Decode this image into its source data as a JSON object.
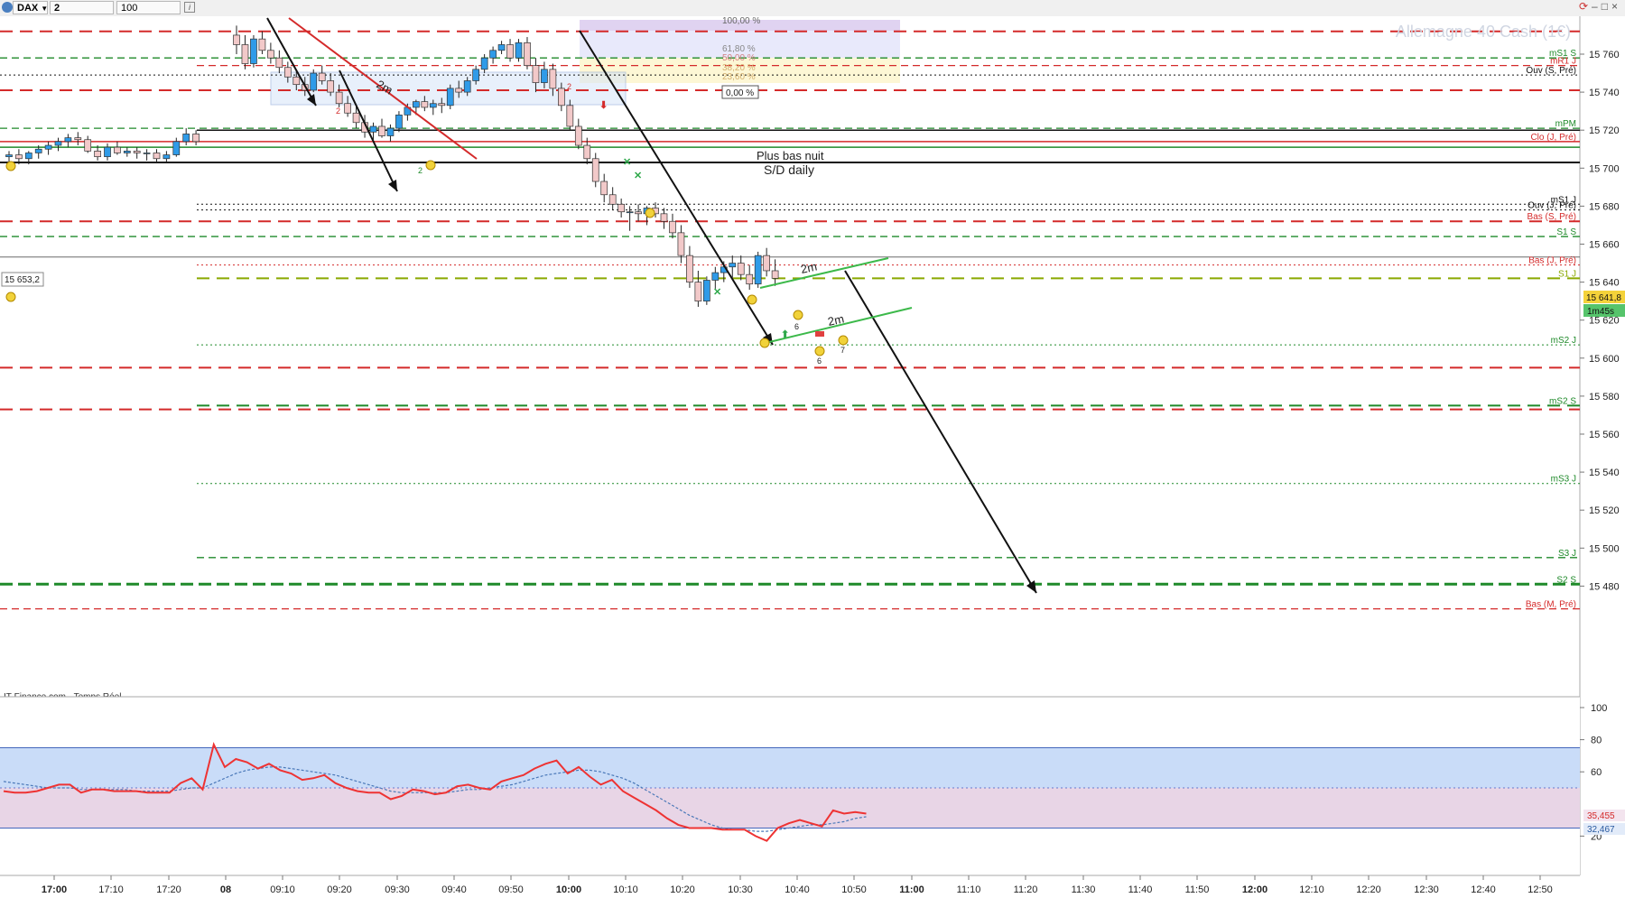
{
  "toolbar": {
    "symbol": "DAX",
    "timeframe": "2 minutes",
    "units": "100 unités"
  },
  "instrument_title": "Allemagne 40 Cash (1€)",
  "source_label": "IT-Finance.com - Temps Réel",
  "colors": {
    "resistance": "#d42a2a",
    "support": "#1f8a2a",
    "pivot": "#111111",
    "bull_candle": "#2f9be8",
    "bear_candle": "#f2c9c9",
    "rsi_line": "#ee3333",
    "rsi_signal": "#4a78b8",
    "rsi_upper_zone": "#c9dcf8",
    "rsi_lower_zone": "#e8d5e6"
  },
  "chart_data": {
    "type": "candlestick",
    "ylim": [
      15465,
      15775
    ],
    "price_ticks": [
      15760,
      15740,
      15720,
      15700,
      15680,
      15660,
      15640,
      15620,
      15600,
      15580,
      15560,
      15540,
      15520,
      15500,
      15480
    ],
    "price_tick_labels": [
      "15 760",
      "15 740",
      "15 720",
      "15 700",
      "15 680",
      "15 660",
      "15 640",
      "15 620",
      "15 600",
      "15 580",
      "15 560",
      "15 540",
      "15 520",
      "15 500",
      "15 480"
    ],
    "time_ticks": [
      "17:00",
      "17:10",
      "17:20",
      "08",
      "09:10",
      "09:20",
      "09:30",
      "09:40",
      "09:50",
      "10:00",
      "10:10",
      "10:20",
      "10:30",
      "10:40",
      "10:50",
      "11:00",
      "11:10",
      "11:20",
      "11:30",
      "11:40",
      "11:50",
      "12:00",
      "12:10",
      "12:20",
      "12:30",
      "12:40",
      "12:50"
    ],
    "time_tick_bold": [
      true,
      false,
      false,
      true,
      false,
      false,
      false,
      false,
      false,
      true,
      false,
      false,
      false,
      false,
      false,
      true,
      false,
      false,
      false,
      false,
      false,
      true,
      false,
      false,
      false,
      false,
      false
    ],
    "candles": [
      [
        15706,
        15709,
        15703,
        15707
      ],
      [
        15707,
        15710,
        15702,
        15705
      ],
      [
        15705,
        15709,
        15702,
        15708
      ],
      [
        15708,
        15712,
        15705,
        15710
      ],
      [
        15710,
        15714,
        15707,
        15712
      ],
      [
        15712,
        15716,
        15709,
        15714
      ],
      [
        15714,
        15718,
        15711,
        15716
      ],
      [
        15716,
        15719,
        15712,
        15715
      ],
      [
        15715,
        15717,
        15708,
        15709
      ],
      [
        15709,
        15712,
        15704,
        15706
      ],
      [
        15706,
        15713,
        15704,
        15711
      ],
      [
        15711,
        15714,
        15707,
        15708
      ],
      [
        15708,
        15711,
        15706,
        15709
      ],
      [
        15709,
        15711,
        15705,
        15708
      ],
      [
        15708,
        15710,
        15704,
        15708
      ],
      [
        15708,
        15710,
        15703,
        15705
      ],
      [
        15705,
        15709,
        15703,
        15707
      ],
      [
        15707,
        15716,
        15706,
        15714
      ],
      [
        15714,
        15721,
        15712,
        15718
      ],
      [
        15718,
        15720,
        15712,
        15714
      ],
      [
        15770,
        15775,
        15760,
        15765
      ],
      [
        15765,
        15770,
        15752,
        15755
      ],
      [
        15755,
        15770,
        15753,
        15768
      ],
      [
        15768,
        15772,
        15760,
        15762
      ],
      [
        15762,
        15766,
        15755,
        15758
      ],
      [
        15758,
        15762,
        15750,
        15753
      ],
      [
        15753,
        15756,
        15745,
        15748
      ],
      [
        15748,
        15752,
        15741,
        15744
      ],
      [
        15744,
        15748,
        15738,
        15741
      ],
      [
        15741,
        15752,
        15740,
        15750
      ],
      [
        15750,
        15754,
        15744,
        15746
      ],
      [
        15746,
        15750,
        15738,
        15740
      ],
      [
        15740,
        15744,
        15732,
        15734
      ],
      [
        15734,
        15738,
        15727,
        15729
      ],
      [
        15729,
        15733,
        15721,
        15724
      ],
      [
        15724,
        15728,
        15716,
        15719
      ],
      [
        15719,
        15724,
        15715,
        15722
      ],
      [
        15722,
        15726,
        15716,
        15717
      ],
      [
        15717,
        15723,
        15714,
        15721
      ],
      [
        15721,
        15730,
        15719,
        15728
      ],
      [
        15728,
        15734,
        15725,
        15732
      ],
      [
        15732,
        15736,
        15728,
        15735
      ],
      [
        15735,
        15738,
        15730,
        15732
      ],
      [
        15732,
        15736,
        15728,
        15734
      ],
      [
        15734,
        15737,
        15729,
        15733
      ],
      [
        15733,
        15744,
        15731,
        15742
      ],
      [
        15742,
        15746,
        15737,
        15740
      ],
      [
        15740,
        15748,
        15738,
        15746
      ],
      [
        15746,
        15754,
        15744,
        15752
      ],
      [
        15752,
        15760,
        15750,
        15758
      ],
      [
        15758,
        15764,
        15755,
        15762
      ],
      [
        15762,
        15767,
        15760,
        15765
      ],
      [
        15765,
        15768,
        15756,
        15758
      ],
      [
        15758,
        15768,
        15756,
        15766
      ],
      [
        15766,
        15769,
        15752,
        15754
      ],
      [
        15754,
        15758,
        15740,
        15745
      ],
      [
        15745,
        15756,
        15742,
        15752
      ],
      [
        15752,
        15755,
        15738,
        15742
      ],
      [
        15742,
        15745,
        15730,
        15733
      ],
      [
        15733,
        15736,
        15720,
        15722
      ],
      [
        15722,
        15726,
        15710,
        15712
      ],
      [
        15712,
        15716,
        15702,
        15705
      ],
      [
        15705,
        15708,
        15690,
        15693
      ],
      [
        15693,
        15697,
        15682,
        15686
      ],
      [
        15686,
        15690,
        15678,
        15681
      ],
      [
        15681,
        15684,
        15674,
        15677
      ],
      [
        15677,
        15680,
        15667,
        15677
      ],
      [
        15677,
        15681,
        15672,
        15676
      ],
      [
        15676,
        15680,
        15670,
        15679
      ],
      [
        15679,
        15682,
        15674,
        15676
      ],
      [
        15676,
        15679,
        15668,
        15672
      ],
      [
        15672,
        15676,
        15663,
        15666
      ],
      [
        15666,
        15670,
        15650,
        15654
      ],
      [
        15654,
        15659,
        15637,
        15640
      ],
      [
        15640,
        15646,
        15627,
        15630
      ],
      [
        15630,
        15643,
        15628,
        15641
      ],
      [
        15641,
        15648,
        15636,
        15645
      ],
      [
        15645,
        15651,
        15640,
        15648
      ],
      [
        15648,
        15654,
        15642,
        15650
      ],
      [
        15650,
        15654,
        15641,
        15644
      ],
      [
        15644,
        15649,
        15636,
        15639
      ],
      [
        15639,
        15656,
        15637,
        15654
      ],
      [
        15654,
        15658,
        15643,
        15646
      ],
      [
        15646,
        15652,
        15638,
        15642
      ]
    ],
    "levels": [
      {
        "price": 15772,
        "style": "dash-long",
        "color": "#d42a2a",
        "label": "",
        "from": 0
      },
      {
        "price": 15758,
        "style": "dash",
        "color": "#1f8a2a",
        "label": "mS1 S",
        "from": 0
      },
      {
        "price": 15754,
        "style": "dash",
        "color": "#d42a2a",
        "label": "mR1 J",
        "from": 218
      },
      {
        "price": 15749,
        "style": "dot",
        "color": "#111111",
        "label": "Ouv (S, Pré)",
        "from": 0
      },
      {
        "price": 15741,
        "style": "dash-long",
        "color": "#d42a2a",
        "label": "",
        "from": 0
      },
      {
        "price": 15721,
        "style": "dash",
        "color": "#1f8a2a",
        "label": "mPM",
        "from": 0
      },
      {
        "price": 15720,
        "style": "solid",
        "color": "#111111",
        "label": "",
        "from": 218
      },
      {
        "price": 15714,
        "style": "solid",
        "color": "#d42a2a",
        "label": "Clo (J, Pré)",
        "from": 0
      },
      {
        "price": 15711,
        "style": "solid",
        "color": "#1f8a2a",
        "label": "",
        "from": 0
      },
      {
        "price": 15703,
        "style": "solid-thick",
        "color": "#111111",
        "label": "",
        "from": 0
      },
      {
        "price": 15681,
        "style": "dot",
        "color": "#111111",
        "label": "mS1 J",
        "from": 218
      },
      {
        "price": 15678,
        "style": "dot",
        "color": "#111111",
        "label": "Ouv (J, Pré)",
        "from": 218
      },
      {
        "price": 15672,
        "style": "dash-long",
        "color": "#d42a2a",
        "label": "Bas (S, Pré)",
        "from": 0
      },
      {
        "price": 15664,
        "style": "dash",
        "color": "#1f8a2a",
        "label": "S1 S",
        "from": 0
      },
      {
        "price": 15653.2,
        "style": "solid-thin",
        "color": "#555555",
        "label": "",
        "from": 0
      },
      {
        "price": 15649,
        "style": "dot",
        "color": "#d42a2a",
        "label": "Bas (J, Pré)",
        "from": 218
      },
      {
        "price": 15642,
        "style": "dash-long",
        "color": "#8aa800",
        "label": "S1 J",
        "from": 218
      },
      {
        "price": 15607,
        "style": "dot",
        "color": "#1f8a2a",
        "label": "mS2 J",
        "from": 218
      },
      {
        "price": 15595,
        "style": "dash-long",
        "color": "#d42a2a",
        "label": "",
        "from": 0
      },
      {
        "price": 15575,
        "style": "dash-long",
        "color": "#1f8a2a",
        "label": "mS2 S",
        "from": 218
      },
      {
        "price": 15573,
        "style": "dash-long",
        "color": "#d42a2a",
        "label": "",
        "from": 0
      },
      {
        "price": 15534,
        "style": "dot",
        "color": "#1f8a2a",
        "label": "mS3 J",
        "from": 218
      },
      {
        "price": 15495,
        "style": "dash",
        "color": "#1f8a2a",
        "label": "S3 J",
        "from": 218
      },
      {
        "price": 15481,
        "style": "dash-long-thick",
        "color": "#1f8a2a",
        "label": "S2 S",
        "from": 0
      },
      {
        "price": 15468,
        "style": "dash",
        "color": "#d42a2a",
        "label": "Bas (M, Pré)",
        "from": 0
      }
    ],
    "annotations": [
      {
        "text": "Plus bas nuit",
        "price": 15713,
        "color": "#222222"
      },
      {
        "text": "S/D daily",
        "price": 15707,
        "color": "#222222"
      },
      {
        "text": "2m",
        "price": 15748,
        "color": "#222222"
      },
      {
        "text": "2m",
        "price": 15659,
        "color": "#222222"
      },
      {
        "text": "2m",
        "price": 15636,
        "color": "#222222"
      }
    ],
    "fibo_labels": [
      "100,00 %",
      "61,80 %",
      "50,00 %",
      "38,20 %",
      "23,60 %",
      "0,00 %"
    ],
    "current_price": "15 641,8",
    "countdown": "1m45s",
    "ref_label": "15 653,2",
    "rsi": {
      "ylim": [
        0,
        100
      ],
      "ticks": [
        100,
        80,
        60,
        20
      ],
      "bands": [
        75,
        25
      ],
      "midline": 50,
      "value_label": "35,455",
      "signal_label": "32,467",
      "values": [
        48,
        47,
        47,
        48,
        50,
        52,
        52,
        47,
        49,
        49,
        48,
        48,
        48,
        47,
        47,
        47,
        53,
        56,
        49,
        77,
        63,
        68,
        66,
        62,
        65,
        61,
        59,
        55,
        56,
        58,
        53,
        50,
        48,
        47,
        47,
        43,
        45,
        49,
        48,
        46,
        47,
        51,
        52,
        50,
        49,
        54,
        56,
        58,
        62,
        65,
        67,
        59,
        63,
        57,
        52,
        55,
        48,
        44,
        40,
        36,
        31,
        27,
        25,
        25,
        25,
        24,
        24,
        24,
        20,
        17,
        25,
        28,
        30,
        28,
        26,
        36,
        34,
        35,
        34
      ],
      "signal": [
        54,
        53,
        52,
        51,
        50,
        50,
        50,
        49,
        49,
        49,
        49,
        49,
        48,
        48,
        48,
        48,
        49,
        50,
        50,
        53,
        56,
        59,
        61,
        62,
        63,
        63,
        62,
        61,
        60,
        59,
        58,
        56,
        54,
        52,
        50,
        48,
        47,
        47,
        47,
        47,
        47,
        48,
        49,
        49,
        50,
        51,
        52,
        54,
        56,
        58,
        59,
        60,
        61,
        61,
        60,
        58,
        56,
        53,
        49,
        45,
        41,
        37,
        33,
        30,
        27,
        25,
        24,
        24,
        23,
        23,
        24,
        25,
        26,
        27,
        27,
        28,
        29,
        31,
        32
      ]
    },
    "indicator_markers": [
      {
        "text": "2",
        "price": 15735,
        "color": "#d42a2a"
      },
      {
        "text": "2",
        "price": 15713,
        "color": "#1f8a2a"
      },
      {
        "text": "2",
        "price": 15753,
        "color": "#d42a2a"
      },
      {
        "text": "6",
        "price": 15638,
        "color": "#222222"
      },
      {
        "text": "6",
        "price": 15620,
        "color": "#222222"
      },
      {
        "text": "7",
        "price": 15624,
        "color": "#222222"
      }
    ]
  }
}
